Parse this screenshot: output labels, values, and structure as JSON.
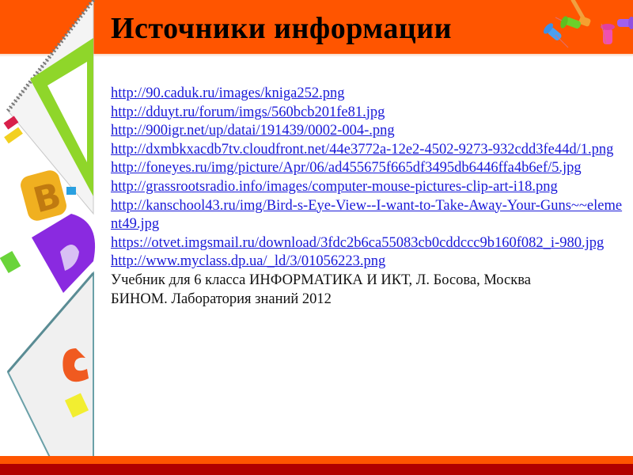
{
  "slide": {
    "title": "Источники информации",
    "colors": {
      "header": "#ff5500",
      "footer_orange": "#ff5500",
      "footer_red": "#b00000",
      "link": "#1a1ad8",
      "text": "#111111"
    },
    "links": [
      "http://90.caduk.ru/images/kniga252.png",
      "http://dduyt.ru/forum/imgs/560bcb201fe81.jpg",
      "http://900igr.net/up/datai/191439/0002-004-.png",
      "http://dxmbkxacdb7tv.cloudfront.net/44e3772a-12e2-4502-9273-932cdd3fe44d/1.png",
      "http://foneyes.ru/img/picture/Apr/06/ad455675f665df3495db6446ffa4b6ef/5.jpg",
      "http://grassrootsradio.info/images/computer-mouse-pictures-clip-art-i18.png",
      "http://kanschool43.ru/img/Bird-s-Eye-View--I-want-to-Take-Away-Your-Guns~~element49.jpg",
      "https://otvet.imgsmail.ru/download/3fdc2b6ca55083cb0cddccc9b160f082_i-980.jpg",
      "http://www.myclass.dp.ua/_ld/3/01056223.png"
    ],
    "reference_line1": "Учебник для 6 класса ИНФОРМАТИКА И ИКТ, Л. Босова, Москва",
    "reference_line2": "БИНОМ. Лаборатория знаний 2012",
    "decorations": {
      "left": [
        "notebook-icon",
        "triangle-ruler-icon",
        "letter-b-icon",
        "letter-d-icon",
        "open-book-icon",
        "letter-c-icon",
        "letter-m-icon"
      ],
      "header_right": [
        "push-pins-icon"
      ]
    }
  }
}
